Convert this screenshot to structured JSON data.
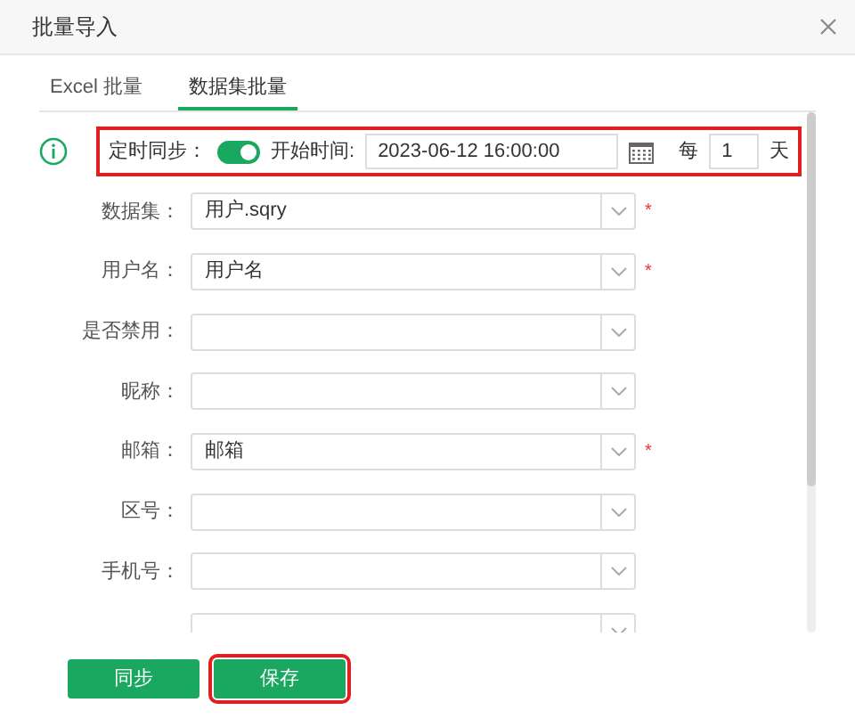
{
  "dialog": {
    "title": "批量导入"
  },
  "tabs": [
    {
      "label": "Excel 批量",
      "selected": false
    },
    {
      "label": "数据集批量",
      "selected": true
    }
  ],
  "schedule": {
    "highlighted": true,
    "label": "定时同步：",
    "on": true,
    "start_label": "开始时间:",
    "start_value": "2023-06-12 16:00:00",
    "every_label": "每",
    "interval": "1",
    "unit": "天"
  },
  "fields": [
    {
      "kind": "select",
      "label": "数据集：",
      "value": "用户.sqry",
      "required_mark": "*"
    },
    {
      "kind": "select",
      "label": "用户名：",
      "value": "用户名",
      "required_mark": "*"
    },
    {
      "kind": "select",
      "label": "是否禁用："
    },
    {
      "kind": "select",
      "label": "昵称："
    },
    {
      "kind": "select",
      "label": "邮箱：",
      "value": "邮箱",
      "required_mark": "*"
    },
    {
      "kind": "select",
      "label": "区号："
    },
    {
      "kind": "select",
      "label": "手机号："
    },
    {
      "kind": "select"
    }
  ],
  "buttons": [
    {
      "label": "同步",
      "highlighted": false
    },
    {
      "label": "保存",
      "highlighted": true
    }
  ]
}
